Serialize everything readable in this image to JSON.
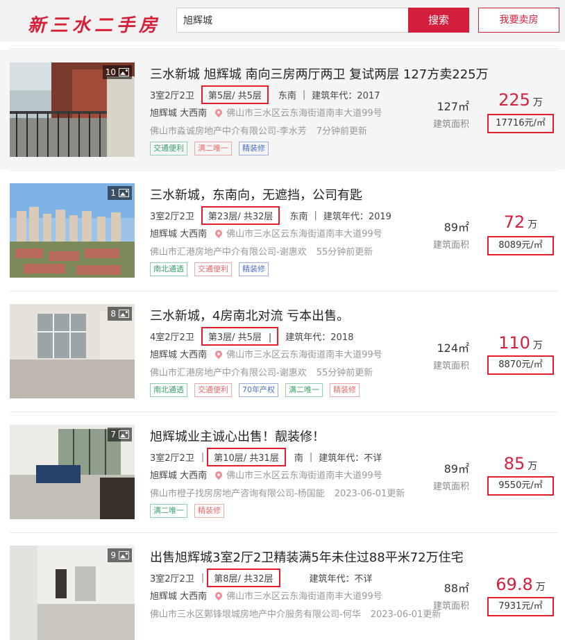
{
  "header": {
    "logo": "新三水二手房",
    "search_value": "旭辉城",
    "search_button": "搜索",
    "sell_button": "我要卖房"
  },
  "listings": [
    {
      "pic_count": "10",
      "title": "三水新城 旭辉城 南向三房两厅两卫 复试两层 127方卖225万",
      "layout": "3室2厅2卫",
      "floor": "第5层/ 共5层",
      "orientation": "东南",
      "year": "建筑年代：2017",
      "area": "旭辉城 大西南",
      "address": "佛山市三水区云东海街道南丰大道99号",
      "agent": "佛山市淼诚房地产中介有限公司-李水芳",
      "updated": "7分钟前更新",
      "tags": [
        {
          "text": "交通便利",
          "color": "green"
        },
        {
          "text": "满二唯一",
          "color": "red"
        },
        {
          "text": "精装修",
          "color": "blue"
        }
      ],
      "size": "127㎡",
      "size_label": "建筑面积",
      "price": "225",
      "price_unit": "万",
      "unit_price": "17716元/㎡"
    },
    {
      "pic_count": "1",
      "title": "三水新城，东南向，无遮挡，公司有匙",
      "layout": "3室2厅2卫",
      "floor": "第23层/ 共32层",
      "orientation": "东南",
      "year": "建筑年代：2019",
      "area": "旭辉城 大西南",
      "address": "佛山市三水区云东海街道南丰大道99号",
      "agent": "佛山市汇港房地产中介有限公司-谢惠欢",
      "updated": "55分钟前更新",
      "tags": [
        {
          "text": "南北通透",
          "color": "green"
        },
        {
          "text": "交通便利",
          "color": "red"
        },
        {
          "text": "精装修",
          "color": "blue"
        }
      ],
      "size": "89㎡",
      "size_label": "建筑面积",
      "price": "72",
      "price_unit": "万",
      "unit_price": "8089元/㎡"
    },
    {
      "pic_count": "8",
      "title": "三水新城，4房南北对流 亏本出售。",
      "layout": "4室2厅2卫",
      "floor": "第3层/ 共5层",
      "orientation": "",
      "year": "建筑年代：2018",
      "area": "旭辉城 大西南",
      "address": "佛山市三水区云东海街道南丰大道99号",
      "agent": "佛山市汇港房地产中介有限公司-谢惠欢",
      "updated": "55分钟前更新",
      "tags": [
        {
          "text": "南北通透",
          "color": "green"
        },
        {
          "text": "交通便利",
          "color": "red"
        },
        {
          "text": "70年产权",
          "color": "blue"
        },
        {
          "text": "满二唯一",
          "color": "green"
        },
        {
          "text": "精装修",
          "color": "red"
        }
      ],
      "size": "124㎡",
      "size_label": "建筑面积",
      "price": "110",
      "price_unit": "万",
      "unit_price": "8870元/㎡"
    },
    {
      "pic_count": "7",
      "title": "旭辉城业主诚心出售！靓装修！",
      "layout": "3室2厅2卫",
      "floor": "第10层/ 共31层",
      "orientation": "南",
      "year": "建筑年代：不详",
      "area": "旭辉城 大西南",
      "address": "佛山市三水区云东海街道南丰大道99号",
      "agent": "佛山市橙子找房房地产咨询有限公司-杨国能",
      "updated": "2023-06-01更新",
      "tags": [
        {
          "text": "满二唯一",
          "color": "green"
        },
        {
          "text": "精装修",
          "color": "red"
        }
      ],
      "size": "89㎡",
      "size_label": "建筑面积",
      "price": "85",
      "price_unit": "万",
      "unit_price": "9550元/㎡"
    },
    {
      "pic_count": "9",
      "title": "出售旭辉城3室2厅2卫精装满5年未住过88平米72万住宅",
      "layout": "3室2厅2卫",
      "floor": "第8层/ 共32层",
      "orientation": "",
      "year": "建筑年代：不详",
      "area": "旭辉城 大西南",
      "address": "佛山市三水区云东海街道南丰大道99号",
      "agent": "佛山市三水区鄚锋垠城房地产中介服务有限公司-何华",
      "updated": "2023-06-01更新",
      "tags": [],
      "size": "88㎡",
      "size_label": "建筑面积",
      "price": "69.8",
      "price_unit": "万",
      "unit_price": "7931元/㎡"
    }
  ]
}
